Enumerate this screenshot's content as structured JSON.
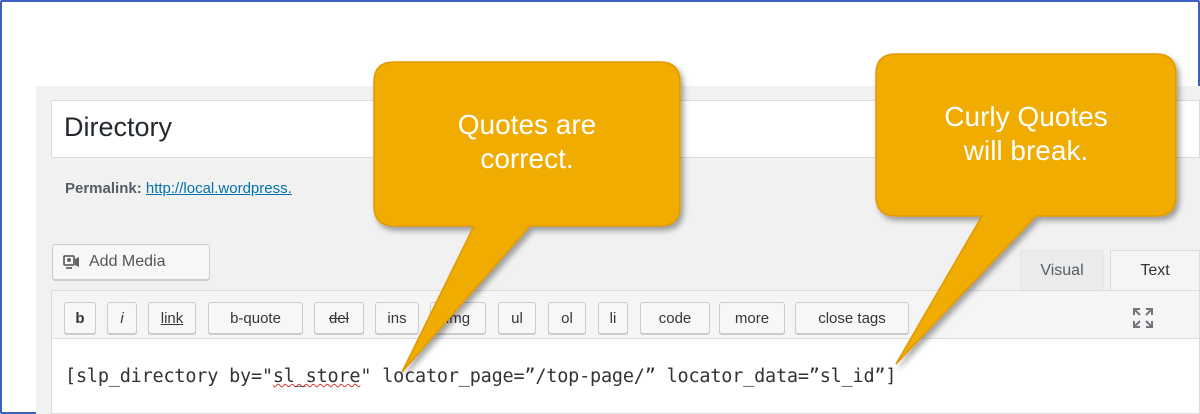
{
  "post": {
    "title": "Directory",
    "permalink_label": "Permalink:",
    "permalink_url": "http://local.wordpress."
  },
  "media": {
    "add_media_label": "Add Media",
    "icon": "media-camera-icon"
  },
  "tabs": [
    {
      "label": "Visual",
      "active": false
    },
    {
      "label": "Text",
      "active": true
    }
  ],
  "toolbar": {
    "buttons": [
      "b",
      "i",
      "link",
      "b-quote",
      "del",
      "ins",
      "img",
      "ul",
      "ol",
      "li",
      "code",
      "more",
      "close tags"
    ],
    "fullscreen_icon": "fullscreen-icon"
  },
  "content": {
    "code_prefix": "[slp_directory by=\"",
    "code_misspelled": "sl_store",
    "code_suffix": "\" locator_page=”/top-page/” locator_data=”sl_id”]"
  },
  "callouts": {
    "left": {
      "line1": "Quotes are",
      "line2": "correct."
    },
    "right": {
      "line1": "Curly Quotes",
      "line2": "will break."
    },
    "color": "#f0ac00"
  },
  "colors": {
    "link": "#0073aa",
    "border": "#3c5fc4",
    "spellcheck": "#d63638"
  }
}
